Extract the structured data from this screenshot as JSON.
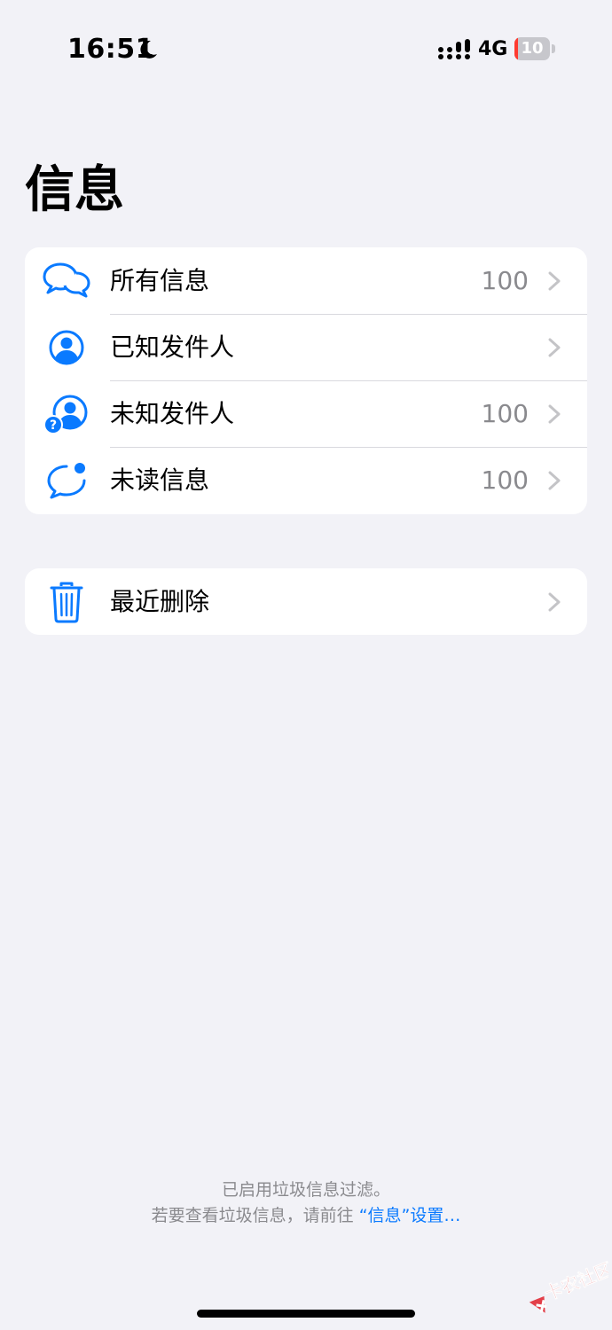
{
  "status_bar": {
    "time": "16:51",
    "network": "4G",
    "battery_level": "10",
    "battery_fraction": 0.1,
    "icons": [
      "moon-icon",
      "signal-icon",
      "battery-icon"
    ]
  },
  "page": {
    "title": "信息"
  },
  "filters": [
    {
      "label": "所有信息",
      "count": "100",
      "icon": "bubbles-icon"
    },
    {
      "label": "已知发件人",
      "count": "",
      "icon": "person-circle-icon"
    },
    {
      "label": "未知发件人",
      "count": "100",
      "icon": "person-question-icon"
    },
    {
      "label": "未读信息",
      "count": "100",
      "icon": "unread-bubble-icon"
    }
  ],
  "recently_deleted": {
    "label": "最近删除",
    "icon": "trash-icon"
  },
  "footer": {
    "line1": "已启用垃圾信息过滤。",
    "line2_prefix": "若要查看垃圾信息，请前往",
    "line2_link": "“信息”设置…"
  },
  "watermark": {
    "text": "卡农社区"
  },
  "colors": {
    "accent": "#0A7AFF",
    "background": "#F2F2F7",
    "battery_low": "#FF3B30"
  }
}
